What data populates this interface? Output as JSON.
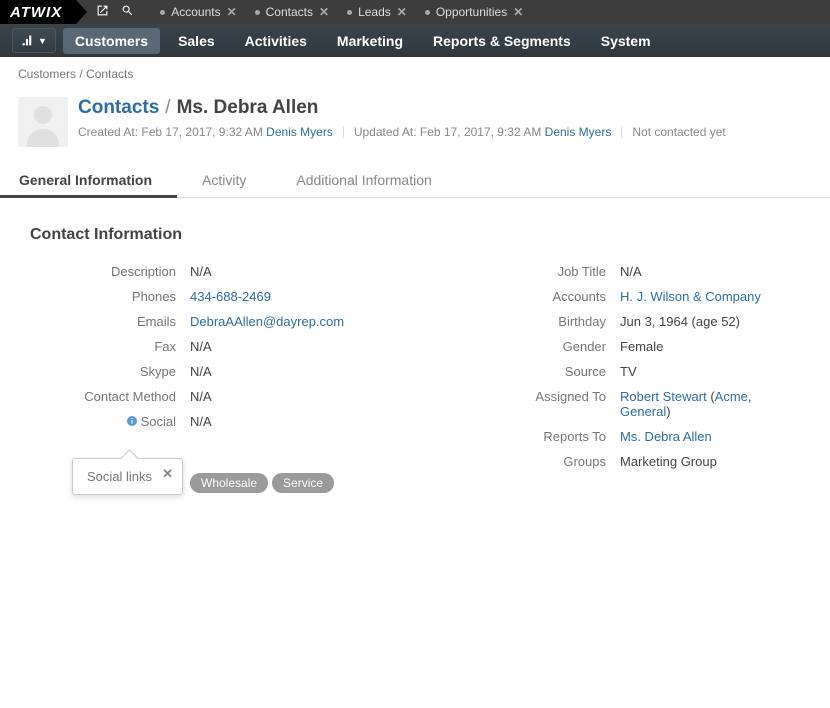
{
  "brand": "ATWIX",
  "pins": [
    {
      "label": "Accounts"
    },
    {
      "label": "Contacts"
    },
    {
      "label": "Leads"
    },
    {
      "label": "Opportunities"
    }
  ],
  "nav": {
    "items": [
      "Customers",
      "Sales",
      "Activities",
      "Marketing",
      "Reports & Segments",
      "System"
    ],
    "active": "Customers"
  },
  "breadcrumb": {
    "root": "Customers",
    "current": "Contacts"
  },
  "record": {
    "entity": "Contacts",
    "name": "Ms. Debra Allen",
    "created_label": "Created At:",
    "created_at": "Feb 17, 2017, 9:32 AM",
    "created_by": "Denis Myers",
    "updated_label": "Updated At:",
    "updated_at": "Feb 17, 2017, 9:32 AM",
    "updated_by": "Denis Myers",
    "status": "Not contacted yet"
  },
  "tabs": [
    {
      "label": "General Information",
      "active": true
    },
    {
      "label": "Activity",
      "active": false
    },
    {
      "label": "Additional Information",
      "active": false
    }
  ],
  "section_title": "Contact Information",
  "left_fields": {
    "description": {
      "label": "Description",
      "value": "N/A"
    },
    "phones": {
      "label": "Phones",
      "value": "434-688-2469",
      "link": true
    },
    "emails": {
      "label": "Emails",
      "value": "DebraAAllen@dayrep.com",
      "link": true
    },
    "fax": {
      "label": "Fax",
      "value": "N/A"
    },
    "skype": {
      "label": "Skype",
      "value": "N/A"
    },
    "contact_method": {
      "label": "Contact Method",
      "value": "N/A"
    },
    "social": {
      "label": "Social",
      "value": "N/A"
    }
  },
  "right_fields": {
    "job_title": {
      "label": "Job Title",
      "value": "N/A"
    },
    "accounts": {
      "label": "Accounts",
      "value": "H. J. Wilson & Company",
      "link": true
    },
    "birthday": {
      "label": "Birthday",
      "value": "Jun 3, 1964 (age 52)"
    },
    "gender": {
      "label": "Gender",
      "value": "Female"
    },
    "source": {
      "label": "Source",
      "value": "TV"
    },
    "assigned_to": {
      "label": "Assigned To",
      "user": "Robert Stewart",
      "org1": "Acme",
      "org2": "General"
    },
    "reports_to": {
      "label": "Reports To",
      "value": "Ms. Debra Allen",
      "link": true
    },
    "groups": {
      "label": "Groups",
      "value": "Marketing Group"
    }
  },
  "tags": [
    "Wholesale",
    "Service"
  ],
  "tooltip": {
    "text": "Social links"
  }
}
